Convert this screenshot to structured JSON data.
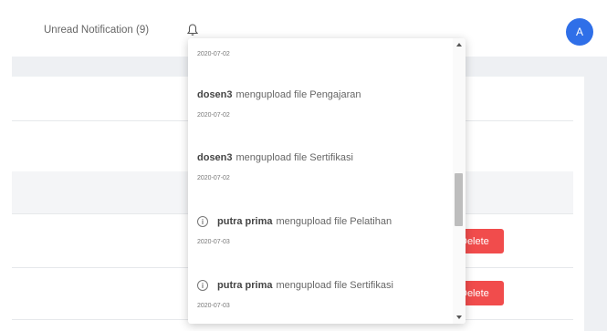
{
  "header": {
    "unread_label": "Unread Notification (9)",
    "bell_icon": "bell-icon",
    "avatar_initial": "A"
  },
  "table": {
    "delete_label": "Delete"
  },
  "notifications": [
    {
      "user": "",
      "action": "",
      "date": "2020-07-02",
      "has_icon": false
    },
    {
      "user": "dosen3",
      "action": "mengupload file Pengajaran",
      "date": "2020-07-02",
      "has_icon": false
    },
    {
      "user": "dosen3",
      "action": "mengupload file Sertifikasi",
      "date": "2020-07-02",
      "has_icon": false
    },
    {
      "user": "putra prima",
      "action": "mengupload file Pelatihan",
      "date": "2020-07-03",
      "has_icon": true
    },
    {
      "user": "putra prima",
      "action": "mengupload file Sertifikasi",
      "date": "2020-07-03",
      "has_icon": true
    }
  ],
  "colors": {
    "avatar": "#2f6fe8",
    "delete": "#f14c4c"
  }
}
